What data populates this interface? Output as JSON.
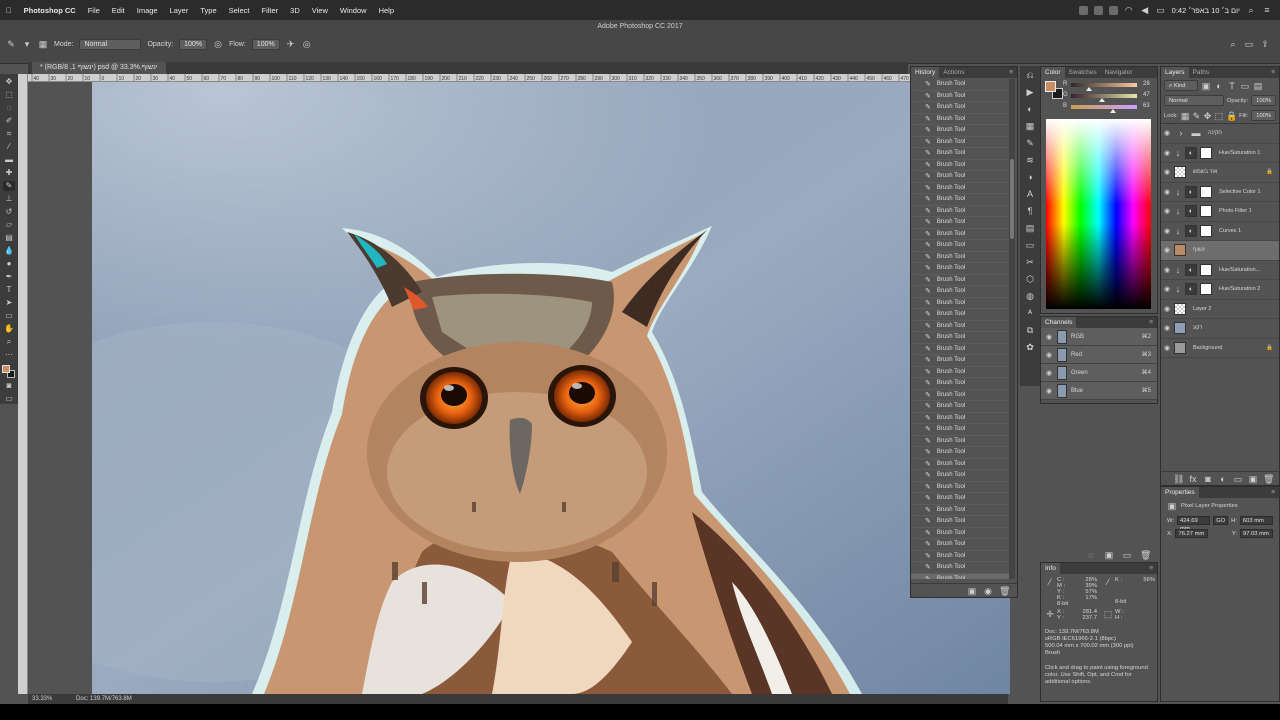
{
  "menubar": {
    "apple_icon": "apple-icon",
    "app_name": "Photoshop CC",
    "items": [
      "File",
      "Edit",
      "Image",
      "Layer",
      "Type",
      "Select",
      "Filter",
      "3D",
      "View",
      "Window",
      "Help"
    ],
    "clock": "יום ב׳ 10 באפר׳ 0:42"
  },
  "window_title": "Adobe Photoshop CC 2017",
  "options": {
    "mode_label": "Mode:",
    "mode_value": "Normal",
    "opacity_label": "Opacity:",
    "opacity_value": "100%",
    "flow_label": "Flow:",
    "flow_value": "100%"
  },
  "document_tab": "* (RGB/8 ,1 ינשוף) psd @ 33.3%.ינשוף",
  "ruler_ticks": [
    "40",
    "30",
    "20",
    "10",
    "0",
    "10",
    "20",
    "30",
    "40",
    "50",
    "60",
    "70",
    "80",
    "90",
    "100",
    "110",
    "120",
    "130",
    "140",
    "150",
    "160",
    "170",
    "180",
    "190",
    "200",
    "210",
    "220",
    "230",
    "240",
    "250",
    "260",
    "270",
    "280",
    "290",
    "300",
    "310",
    "320",
    "330",
    "340",
    "350",
    "360",
    "370",
    "380",
    "390",
    "400",
    "410",
    "420",
    "430",
    "440",
    "450",
    "460",
    "470",
    "480"
  ],
  "status": {
    "zoom": "33.33%",
    "doc": "Doc: 139.7M/763.8M"
  },
  "history": {
    "tabs": [
      "History",
      "Actions"
    ],
    "item_label": "Brush Tool",
    "item_count": 44
  },
  "color_panel": {
    "tabs": [
      "Color",
      "Swatches",
      "Navigator"
    ],
    "sliders": [
      {
        "label": "R",
        "value": "28",
        "unit": "%"
      },
      {
        "label": "G",
        "value": "47",
        "unit": "%"
      },
      {
        "label": "B",
        "value": "63",
        "unit": "%"
      }
    ],
    "foreground_color": "#c98f63",
    "background_color": "#1a1a1a"
  },
  "channels": {
    "title": "Channels",
    "rows": [
      {
        "name": "RGB",
        "shortcut": "⌘2"
      },
      {
        "name": "Red",
        "shortcut": "⌘3"
      },
      {
        "name": "Green",
        "shortcut": "⌘4"
      },
      {
        "name": "Blue",
        "shortcut": "⌘5"
      }
    ]
  },
  "info": {
    "title": "Info",
    "c": "C :",
    "c_val": "28%",
    "m": "M :",
    "m_val": "39%",
    "y": "Y :",
    "y_val": "57%",
    "k": "K :",
    "k_val": "17%",
    "k2": "K :",
    "k2_val": "56%",
    "bit1": "8-bit",
    "bit2": "8-bit",
    "x": "X :",
    "x_val": "281.4",
    "y2": "Y :",
    "y2_val": "237.7",
    "w": "W :",
    "h": "H :",
    "doc": "Doc: 139.7M/763.8M",
    "profile": "sRGB IEC61966-2.1 (8bpc)",
    "size": "500.04 mm x 700.02 mm (300 ppi)",
    "tool": "Brush",
    "hint": "Click and drag to paint using foreground color.  Use Shift, Opt, and Cmd for additional options."
  },
  "layers": {
    "tabs": [
      "Layers",
      "Paths"
    ],
    "filter": "Kind",
    "blend": "Normal",
    "opacity_label": "Opacity:",
    "opacity_value": "100%",
    "lock_label": "Lock:",
    "fill_label": "Fill:",
    "fill_value": "100%",
    "rows": [
      {
        "name": "חקינה",
        "kind": "group"
      },
      {
        "name": "Hue/Saturation 1",
        "kind": "adj"
      },
      {
        "name": "אור בשמש",
        "kind": "pixel"
      },
      {
        "name": "Selective Color 1",
        "kind": "adj"
      },
      {
        "name": "Photo Filter 1",
        "kind": "adj"
      },
      {
        "name": "Curves 1",
        "kind": "adj"
      },
      {
        "name": "ינשוף",
        "kind": "photo",
        "selected": true
      },
      {
        "name": "Hue/Saturation...",
        "kind": "adj"
      },
      {
        "name": "Hue/Saturation 2",
        "kind": "adj"
      },
      {
        "name": "Layer 2",
        "kind": "pixel"
      },
      {
        "name": "רקע",
        "kind": "sky"
      },
      {
        "name": "Background",
        "kind": "bg"
      }
    ]
  },
  "properties": {
    "title": "Properties",
    "subtitle": "Pixel Layer Properties",
    "w_label": "W:",
    "w_value": "424.69 mm",
    "go_label": "GO",
    "h_label": "H:",
    "h_value": "603 mm",
    "x_label": "X:",
    "x_value": "76.27 mm",
    "y_label": "Y:",
    "y_value": "97.03 mm"
  }
}
